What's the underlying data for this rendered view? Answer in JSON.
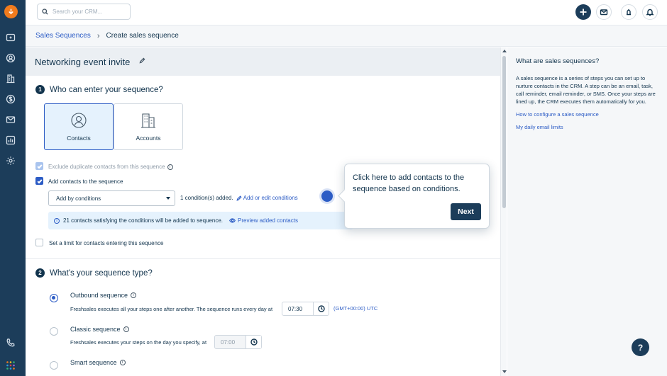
{
  "search": {
    "placeholder": "Search your CRM..."
  },
  "breadcrumb": {
    "parent": "Sales Sequences",
    "current": "Create sales sequence"
  },
  "sequence": {
    "title": "Networking event invite"
  },
  "step1": {
    "number": "1",
    "title": "Who can enter your sequence?",
    "cards": [
      {
        "label": "Contacts"
      },
      {
        "label": "Accounts"
      }
    ],
    "exclude_duplicates": "Exclude duplicate contacts from this sequence",
    "add_contacts": "Add contacts to the sequence",
    "select_value": "Add by conditions",
    "conditions_added": "1 condition(s) added.",
    "edit_conditions": "Add or edit conditions",
    "banner_text": "21 contacts satisfying the conditions will be added to sequence.",
    "preview_link": "Preview added contacts",
    "limit_label": "Set a limit for contacts entering this sequence"
  },
  "step2": {
    "number": "2",
    "title": "What's your sequence type?",
    "options": [
      {
        "title": "Outbound sequence",
        "desc": "Freshsales executes all your steps one after another. The sequence runs every day at",
        "time": "07:30",
        "tz": "(GMT+00:00) UTC",
        "selected": true
      },
      {
        "title": "Classic sequence",
        "desc": "Freshsales executes your steps on the day you specify, at",
        "time": "07:00",
        "selected": false
      },
      {
        "title": "Smart sequence",
        "selected": false
      }
    ]
  },
  "sidebar": {
    "title": "What are sales sequences?",
    "body": "A sales sequence is a series of steps you can set up to nurture contacts in the CRM. A step can be an email, task, call reminder, email reminder, or SMS. Once your steps are lined up, the CRM executes them automatically for you.",
    "links": [
      "How to configure a sales sequence",
      "My daily email limits"
    ]
  },
  "tour": {
    "text": "Click here to add contacts to the sequence based on conditions.",
    "next_label": "Next"
  },
  "help": {
    "label": "?"
  },
  "colors": {
    "rail": "#1c3d5a",
    "accent": "#2c5cc5",
    "logo": "#f07b1d"
  }
}
